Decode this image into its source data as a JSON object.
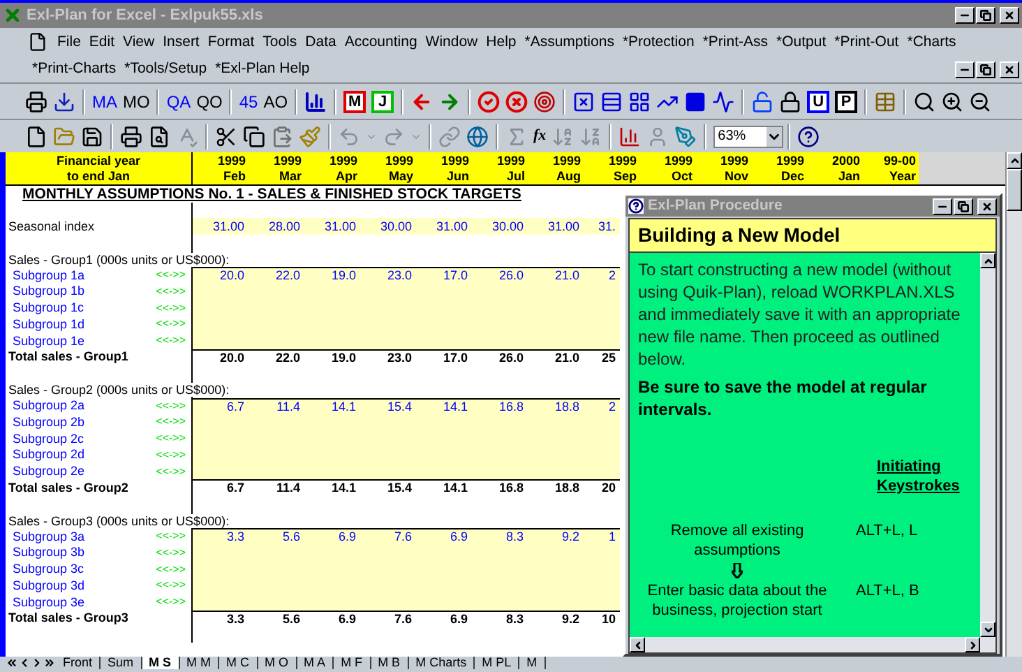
{
  "window": {
    "title": "Exl-Plan for Excel - Exlpuk55.xls"
  },
  "menu_bar": {
    "row_1": [
      "File",
      "Edit",
      "View",
      "Insert",
      "Format",
      "Tools",
      "Data",
      "Accounting",
      "Window",
      "Help",
      "*Assumptions",
      "*Protection",
      "*Print-Ass",
      "*Output",
      "*Print-Out",
      "*Charts"
    ],
    "row_2": [
      "*Print-Charts",
      "*Tools/Setup",
      "*Exl-Plan Help"
    ]
  },
  "toolbar_1": {
    "labels": [
      {
        "label": "MA",
        "color": "#0000ff"
      },
      {
        "label": "MO",
        "color": "#000000"
      },
      {
        "label": "QA",
        "color": "#0000ff"
      },
      {
        "label": "QO",
        "color": "#000000"
      },
      {
        "label": "45",
        "color": "#0000ff"
      },
      {
        "label": "AO",
        "color": "#000000"
      }
    ],
    "boxed_buttons": [
      {
        "label": "M",
        "color": "#e00000"
      },
      {
        "label": "J",
        "color": "#00c000"
      },
      {
        "label": "U",
        "color": "#0000ff"
      },
      {
        "label": "P",
        "color": "#000000"
      }
    ]
  },
  "toolbar_2": {
    "function_label": "fx",
    "zoom": "63%"
  },
  "sheet": {
    "header_label": [
      "Financial year",
      "to end Jan"
    ],
    "columns": [
      {
        "year": "1999",
        "month": "Feb"
      },
      {
        "year": "1999",
        "month": "Mar"
      },
      {
        "year": "1999",
        "month": "Apr"
      },
      {
        "year": "1999",
        "month": "May"
      },
      {
        "year": "1999",
        "month": "Jun"
      },
      {
        "year": "1999",
        "month": "Jul"
      },
      {
        "year": "1999",
        "month": "Aug"
      },
      {
        "year": "1999",
        "month": "Sep"
      },
      {
        "year": "1999",
        "month": "Oct"
      },
      {
        "year": "1999",
        "month": "Nov"
      },
      {
        "year": "1999",
        "month": "Dec"
      },
      {
        "year": "2000",
        "month": "Jan"
      },
      {
        "year": "99-00",
        "month": "Year"
      }
    ],
    "title": "MONTHLY ASSUMPTIONS No. 1 - SALES & FINISHED STOCK TARGETS",
    "seasonal_index": {
      "label": "Seasonal index",
      "values": [
        "31.00",
        "28.00",
        "31.00",
        "30.00",
        "31.00",
        "30.00",
        "31.00",
        "31."
      ]
    },
    "groups": [
      {
        "heading": "Sales - Group1 (000s units or US$000):",
        "subgroups": [
          {
            "label": "Subgroup 1a",
            "marker": "<<->>",
            "values": [
              "20.0",
              "22.0",
              "19.0",
              "23.0",
              "17.0",
              "26.0",
              "21.0",
              "2"
            ]
          },
          {
            "label": "Subgroup 1b",
            "marker": "<<->>"
          },
          {
            "label": "Subgroup 1c",
            "marker": "<<->>"
          },
          {
            "label": "Subgroup 1d",
            "marker": "<<->>"
          },
          {
            "label": "Subgroup 1e",
            "marker": "<<->>"
          }
        ],
        "total": {
          "label": "Total sales - Group1",
          "values": [
            "20.0",
            "22.0",
            "19.0",
            "23.0",
            "17.0",
            "26.0",
            "21.0",
            "25"
          ]
        }
      },
      {
        "heading": "Sales - Group2 (000s units or US$000):",
        "subgroups": [
          {
            "label": "Subgroup 2a",
            "marker": "<<->>",
            "values": [
              "6.7",
              "11.4",
              "14.1",
              "15.4",
              "14.1",
              "16.8",
              "18.8",
              "2"
            ]
          },
          {
            "label": "Subgroup 2b",
            "marker": "<<->>"
          },
          {
            "label": "Subgroup 2c",
            "marker": "<<->>"
          },
          {
            "label": "Subgroup 2d",
            "marker": "<<->>"
          },
          {
            "label": "Subgroup 2e",
            "marker": "<<->>"
          }
        ],
        "total": {
          "label": "Total sales - Group2",
          "values": [
            "6.7",
            "11.4",
            "14.1",
            "15.4",
            "14.1",
            "16.8",
            "18.8",
            "20"
          ]
        }
      },
      {
        "heading": "Sales - Group3 (000s units or US$000):",
        "subgroups": [
          {
            "label": "Subgroup 3a",
            "marker": "<<->>",
            "values": [
              "3.3",
              "5.6",
              "6.9",
              "7.6",
              "6.9",
              "8.3",
              "9.2",
              "1"
            ]
          },
          {
            "label": "Subgroup 3b",
            "marker": "<<->>"
          },
          {
            "label": "Subgroup 3c",
            "marker": "<<->>"
          },
          {
            "label": "Subgroup 3d",
            "marker": "<<->>"
          },
          {
            "label": "Subgroup 3e",
            "marker": "<<->>"
          }
        ],
        "total": {
          "label": "Total sales - Group3",
          "values": [
            "3.3",
            "5.6",
            "6.9",
            "7.6",
            "6.9",
            "8.3",
            "9.2",
            "10"
          ]
        }
      }
    ],
    "tabs": [
      {
        "label": "Front",
        "selected": false
      },
      {
        "label": "Sum",
        "selected": false
      },
      {
        "label": "M S",
        "selected": true
      },
      {
        "label": "M M",
        "selected": false
      },
      {
        "label": "M C",
        "selected": false
      },
      {
        "label": "M O",
        "selected": false
      },
      {
        "label": "M A",
        "selected": false
      },
      {
        "label": "M F",
        "selected": false
      },
      {
        "label": "M B",
        "selected": false
      },
      {
        "label": "M Charts",
        "selected": false
      },
      {
        "label": "M PL",
        "selected": false
      },
      {
        "label": "M",
        "selected": false
      }
    ]
  },
  "dialog": {
    "title": "Exl-Plan Procedure",
    "heading": "Building a New Model",
    "intro": "To start constructing a new model (without using Quik-Plan), reload WORKPLAN.XLS and immediately save it with an appropriate new file name. Then proceed as outlined below.",
    "warning": "Be sure to save the model at regular intervals.",
    "keystrokes_heading": "Initiating Keystrokes",
    "steps": [
      {
        "action": "Remove all existing assumptions",
        "keys": "ALT+L, L"
      },
      {
        "action": "Enter basic data about the business, projection start",
        "keys": "ALT+L, B"
      }
    ]
  }
}
